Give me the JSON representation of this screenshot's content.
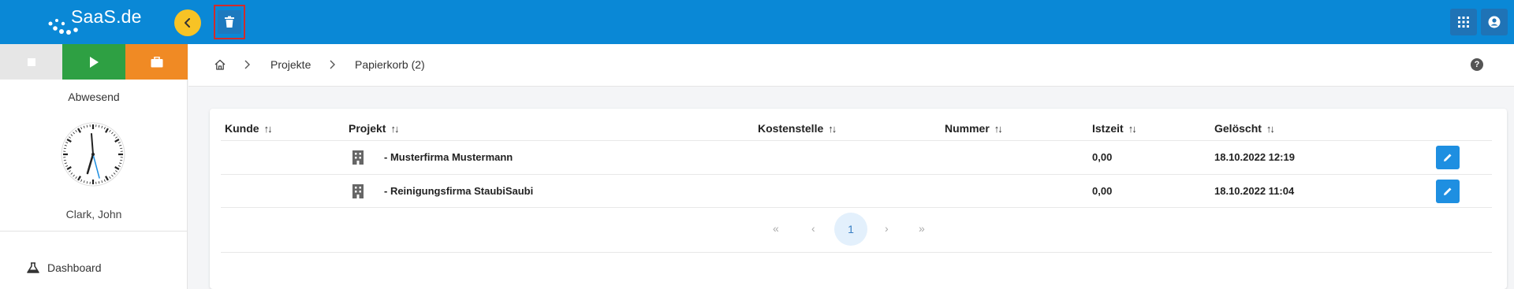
{
  "app": {
    "logo_text": "SaaS.de",
    "colors": {
      "topbar": "#0a88d6",
      "accent_yellow": "#f7c325",
      "play_green": "#2ea043",
      "brief_orange": "#f08a24",
      "edit_blue": "#1e8fe1"
    }
  },
  "toolbar": {
    "back_icon": "chevron-left-icon",
    "trash_icon": "trash-icon",
    "apps_icon": "grid-icon",
    "user_icon": "account-circle-icon"
  },
  "sidebar": {
    "presence_status": "Abwesend",
    "user_name": "Clark, John",
    "nav": [
      {
        "label": "Dashboard",
        "icon": "dashboard-icon"
      }
    ]
  },
  "breadcrumb": {
    "items": [
      "Projekte",
      "Papierkorb (2)"
    ]
  },
  "table": {
    "columns": [
      "Kunde",
      "Projekt",
      "Kostenstelle",
      "Nummer",
      "Istzeit",
      "Gelöscht"
    ],
    "rows": [
      {
        "kunde": "",
        "projekt": "- Musterfirma Mustermann",
        "kostenstelle": "",
        "nummer": "",
        "istzeit": "0,00",
        "geloescht": "18.10.2022 12:19"
      },
      {
        "kunde": "",
        "projekt": "- Reinigungsfirma StaubiSaubi",
        "kostenstelle": "",
        "nummer": "",
        "istzeit": "0,00",
        "geloescht": "18.10.2022 11:04"
      }
    ]
  },
  "pagination": {
    "first": "«",
    "prev": "‹",
    "current": "1",
    "next": "›",
    "last": "»"
  }
}
